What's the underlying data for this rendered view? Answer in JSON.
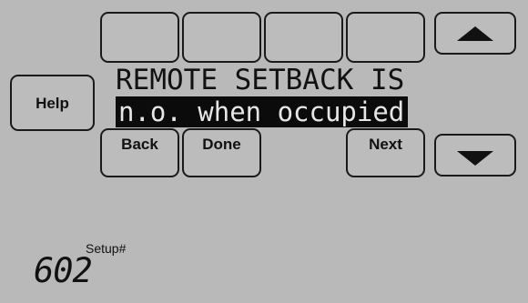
{
  "buttons": {
    "help": "Help",
    "back": "Back",
    "done": "Done",
    "next": "Next",
    "scroll_up": "up",
    "scroll_down": "down"
  },
  "message": {
    "line1": "REMOTE SETBACK IS",
    "line2": "n.o. when occupied"
  },
  "setup": {
    "label": "Setup#",
    "number": "602"
  },
  "icons": {
    "up": "triangle-up-icon",
    "down": "triangle-down-icon"
  },
  "colors": {
    "screen_background": "#b9b9b9",
    "text": "#111111",
    "highlight_background": "#0b0b0b",
    "highlight_text": "#e6e6e6"
  }
}
